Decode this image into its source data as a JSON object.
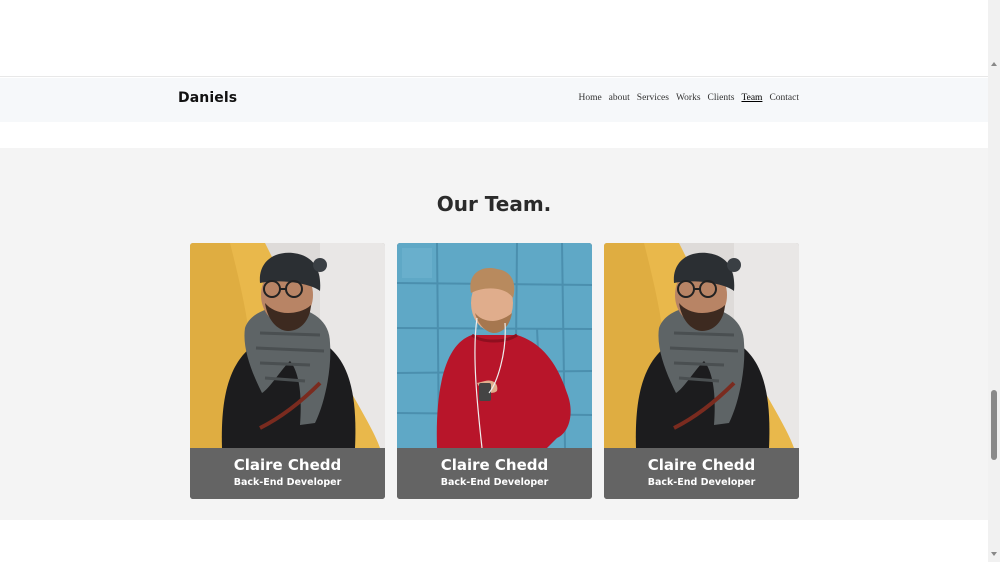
{
  "navbar": {
    "brand": "Daniels",
    "items": [
      {
        "label": "Home"
      },
      {
        "label": "about"
      },
      {
        "label": "Services"
      },
      {
        "label": "Works"
      },
      {
        "label": "Clients"
      },
      {
        "label": "Team",
        "active": true
      },
      {
        "label": "Contact"
      }
    ]
  },
  "team": {
    "title": "Our Team.",
    "members": [
      {
        "name": "Claire Chedd",
        "role": "Back-End Developer",
        "photo": "man-beanie-scarf-yellow-wall"
      },
      {
        "name": "Claire Chedd",
        "role": "Back-End Developer",
        "photo": "man-red-sweater-blue-wall"
      },
      {
        "name": "Claire Chedd",
        "role": "Back-End Developer",
        "photo": "man-beanie-scarf-yellow-wall"
      }
    ]
  },
  "colors": {
    "navbar_bg": "#f6f8fa",
    "section_bg": "#f4f4f4",
    "caption_bg": "#646464"
  }
}
